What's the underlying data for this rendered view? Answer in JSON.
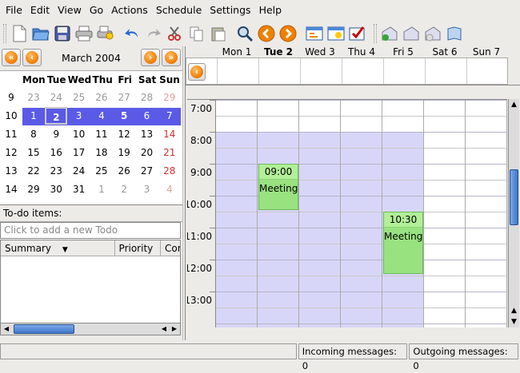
{
  "menu": [
    "File",
    "Edit",
    "View",
    "Go",
    "Actions",
    "Schedule",
    "Settings",
    "Help"
  ],
  "minical": {
    "month": "March 2004",
    "dow": [
      "Mon",
      "Tue",
      "Wed",
      "Thu",
      "Fri",
      "Sat",
      "Sun"
    ],
    "weeks": [
      {
        "wk": "9",
        "days": [
          "23",
          "24",
          "25",
          "26",
          "27",
          "28",
          "29"
        ]
      },
      {
        "wk": "10",
        "days": [
          "1",
          "2",
          "3",
          "4",
          "5",
          "6",
          "7"
        ]
      },
      {
        "wk": "11",
        "days": [
          "8",
          "9",
          "10",
          "11",
          "12",
          "13",
          "14"
        ]
      },
      {
        "wk": "12",
        "days": [
          "15",
          "16",
          "17",
          "18",
          "19",
          "20",
          "21"
        ]
      },
      {
        "wk": "13",
        "days": [
          "22",
          "23",
          "24",
          "25",
          "26",
          "27",
          "28"
        ]
      },
      {
        "wk": "14",
        "days": [
          "29",
          "30",
          "31",
          "1",
          "2",
          "3",
          "4"
        ]
      }
    ]
  },
  "todo": {
    "label": "To-do items:",
    "placeholder": "Click to add a new Todo",
    "columns": [
      "Summary",
      "Priority",
      "Cor"
    ]
  },
  "week": {
    "days": [
      "Mon 1",
      "Tue 2",
      "Wed 3",
      "Thu 4",
      "Fri 5",
      "Sat 6",
      "Sun 7"
    ]
  },
  "hours": [
    "7:00",
    "8:00",
    "9:00",
    "10:00",
    "11:00",
    "12:00",
    "13:00"
  ],
  "events": [
    {
      "time": "09:00",
      "summary": "Meeting"
    },
    {
      "time": "10:30",
      "summary": "Meeting"
    }
  ],
  "status": {
    "incoming": "Incoming messages: 0",
    "outgoing": "Outgoing messages: 0"
  }
}
